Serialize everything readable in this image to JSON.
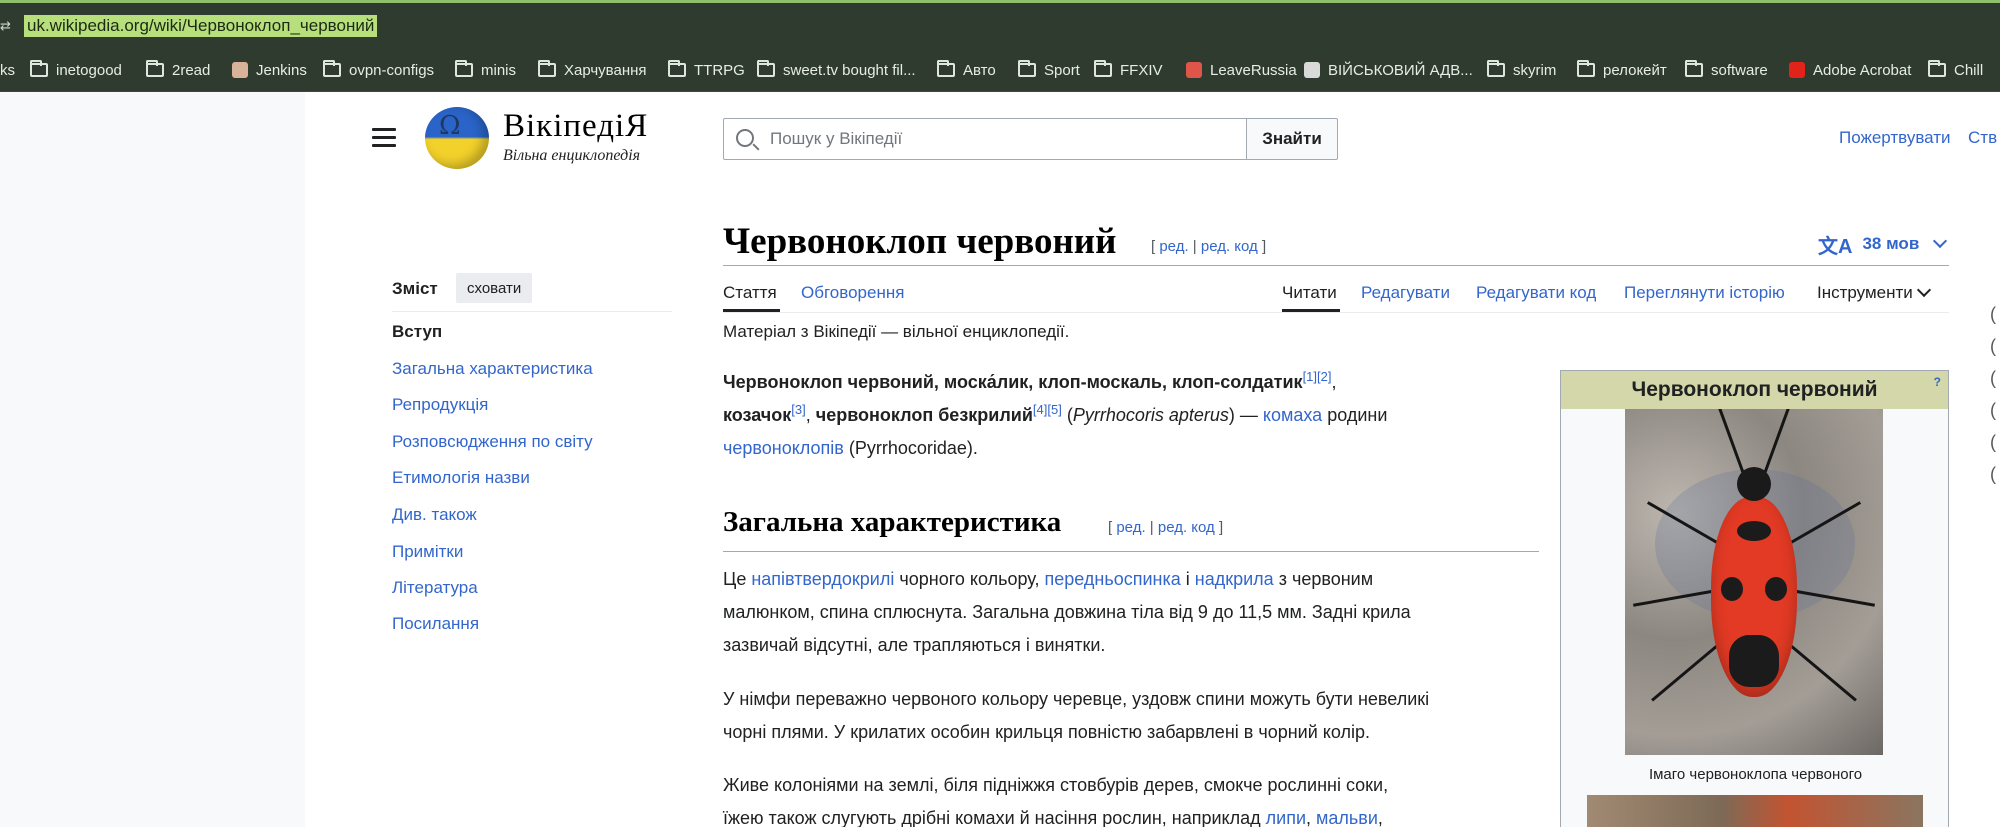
{
  "browser": {
    "url": "uk.wikipedia.org/wiki/Червоноклоп_червоний",
    "bookmarks": [
      {
        "label": "ks",
        "icon": "none"
      },
      {
        "label": "inetogood",
        "icon": "folder-icon"
      },
      {
        "label": "2read",
        "icon": "folder-icon"
      },
      {
        "label": "Jenkins",
        "icon": "jenkins-icon"
      },
      {
        "label": "ovpn-configs",
        "icon": "folder-icon"
      },
      {
        "label": "minis",
        "icon": "folder-icon"
      },
      {
        "label": "Харчування",
        "icon": "folder-icon"
      },
      {
        "label": "TTRPG",
        "icon": "folder-icon"
      },
      {
        "label": "sweet.tv bought fil...",
        "icon": "folder-icon"
      },
      {
        "label": "Авто",
        "icon": "folder-icon"
      },
      {
        "label": "Sport",
        "icon": "folder-icon"
      },
      {
        "label": "FFXIV",
        "icon": "folder-icon"
      },
      {
        "label": "LeaveRussia",
        "icon": "leaverussia-icon"
      },
      {
        "label": "ВІЙСЬКОВИЙ АДВ...",
        "icon": "site-icon"
      },
      {
        "label": "skyrim",
        "icon": "folder-icon"
      },
      {
        "label": "релокейт",
        "icon": "folder-icon"
      },
      {
        "label": "software",
        "icon": "folder-icon"
      },
      {
        "label": "Adobe Acrobat",
        "icon": "acrobat-icon"
      },
      {
        "label": "Chill",
        "icon": "folder-icon"
      }
    ]
  },
  "header": {
    "wordmark": "ВікіпедіЯ",
    "tagline": "Вільна енциклопедія",
    "search_placeholder": "Пошук у Вікіпедії",
    "search_button": "Знайти",
    "donate": "Пожертвувати",
    "create_account": "Ств"
  },
  "toc": {
    "title": "Зміст",
    "hide": "сховати",
    "items": [
      "Вступ",
      "Загальна характеристика",
      "Репродукція",
      "Розповсюдження по світу",
      "Етимологія назви",
      "Див. також",
      "Примітки",
      "Література",
      "Посилання"
    ]
  },
  "article": {
    "title": "Червоноклоп червоний",
    "edit": "ред.",
    "edit_code": "ред. код",
    "languages": "38 мов",
    "tabs_left": [
      "Стаття",
      "Обговорення"
    ],
    "tabs_right": [
      "Читати",
      "Редагувати",
      "Редагувати код",
      "Переглянути історію"
    ],
    "tools": "Інструменти",
    "from": "Матеріал з Вікіпедії — вільної енциклопедії.",
    "lead": {
      "t1": "Червоноклоп червоний, моска́лик, клоп-москаль, клоп-солдатик",
      "r1": "[1][2]",
      "t2": ",",
      "t3": "козачок",
      "r2": "[3]",
      "t4": ", ",
      "t5": "червоноклоп безкрилий",
      "r3": "[4][5]",
      "t6": " (",
      "t7": "Pyrrhocoris apterus",
      "t8": ") — ",
      "link1": "комаха",
      "t9": " родини",
      "link2": "червоноклопів",
      "t10": " (Pyrrhocoridae)."
    },
    "section": {
      "title": "Загальна характеристика",
      "p1": {
        "a": "Це ",
        "l1": "напівтвердокрилі",
        "b": " чорного кольору, ",
        "l2": "передньоспинка",
        "c": " і ",
        "l3": "надкрила",
        "d": " з червоним",
        "e": "малюнком, спина сплюснута. Загальна довжина тіла від 9 до 11,5 мм. Задні крила",
        "f": "зазвичай відсутні, але трапляються і винятки."
      },
      "p2": {
        "a": "У німфи переважно червоного кольору черевце, уздовж спини можуть бути невеликі",
        "b": "чорні плями. У крилатих особин крильця повністю забарвлені в чорний колір."
      },
      "p3": {
        "a": "Живе колоніями на землі, біля підніжжя стовбурів дерев, смокче рослинні соки,",
        "b": "їжею також слугують дрібні комахи й насіння рослин, наприклад ",
        "l1": "липи",
        "c": ", ",
        "l2": "мальви",
        "d": ","
      }
    }
  },
  "infobox": {
    "title": "Червоноклоп червоний",
    "help": "?",
    "caption": "Імаго червоноклопа червоного"
  },
  "colors": {
    "link": "#3366cc",
    "text": "#202122",
    "infobox_header": "#d3d7a9",
    "chrome": "#2f3b2f",
    "url_highlight": "#b7e07d"
  }
}
